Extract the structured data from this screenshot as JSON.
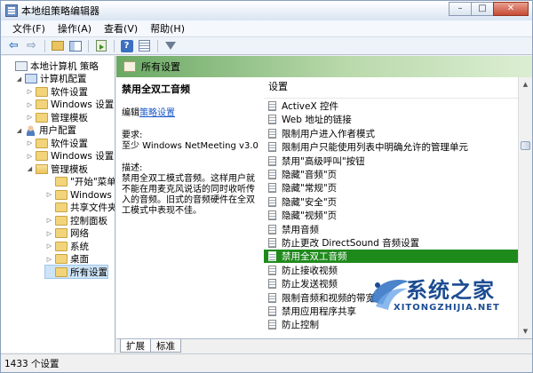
{
  "window": {
    "title": "本地组策略编辑器",
    "controls": {
      "minimize": "–",
      "maximize": "□",
      "close": "✕"
    }
  },
  "menu": [
    "文件(F)",
    "操作(A)",
    "查看(V)",
    "帮助(H)"
  ],
  "toolbar": {
    "icons": [
      "back-arrow-icon",
      "forward-arrow-icon",
      "up-folder-icon",
      "show-pane-icon",
      "export-list-icon",
      "help-icon",
      "properties-icon",
      "filter-icon"
    ],
    "back_glyph": "⇦",
    "forward_glyph": "⇨",
    "help_glyph": "?"
  },
  "tree": [
    {
      "label": "本地计算机 策略",
      "depth": 0,
      "expander": "",
      "icon": "root",
      "selected": false
    },
    {
      "label": "计算机配置",
      "depth": 1,
      "expander": "◢",
      "icon": "computer",
      "selected": false
    },
    {
      "label": "软件设置",
      "depth": 2,
      "expander": "▷",
      "icon": "folder",
      "selected": false
    },
    {
      "label": "Windows 设置",
      "depth": 2,
      "expander": "▷",
      "icon": "folder",
      "selected": false
    },
    {
      "label": "管理模板",
      "depth": 2,
      "expander": "▷",
      "icon": "folder",
      "selected": false
    },
    {
      "label": "用户配置",
      "depth": 1,
      "expander": "◢",
      "icon": "user",
      "selected": false
    },
    {
      "label": "软件设置",
      "depth": 2,
      "expander": "▷",
      "icon": "folder",
      "selected": false
    },
    {
      "label": "Windows 设置",
      "depth": 2,
      "expander": "▷",
      "icon": "folder",
      "selected": false
    },
    {
      "label": "管理模板",
      "depth": 2,
      "expander": "◢",
      "icon": "folder-open",
      "selected": false
    },
    {
      "label": "\"开始\"菜单和",
      "depth": 3,
      "expander": "",
      "icon": "folder",
      "selected": false
    },
    {
      "label": "Windows 组件",
      "depth": 3,
      "expander": "▷",
      "icon": "folder",
      "selected": false
    },
    {
      "label": "共享文件夹",
      "depth": 3,
      "expander": "",
      "icon": "folder",
      "selected": false
    },
    {
      "label": "控制面板",
      "depth": 3,
      "expander": "▷",
      "icon": "folder",
      "selected": false
    },
    {
      "label": "网络",
      "depth": 3,
      "expander": "▷",
      "icon": "folder",
      "selected": false
    },
    {
      "label": "系统",
      "depth": 3,
      "expander": "▷",
      "icon": "folder",
      "selected": false
    },
    {
      "label": "桌面",
      "depth": 3,
      "expander": "▷",
      "icon": "folder",
      "selected": false
    },
    {
      "label": "所有设置",
      "depth": 3,
      "expander": "",
      "icon": "folder",
      "selected": true
    }
  ],
  "panel": {
    "header": "所有设置",
    "description": {
      "title": "禁用全双工音频",
      "edit_prefix": "编辑",
      "edit_link": "策略设置",
      "requirement_label": "要求:",
      "requirement_value": "至少 Windows NetMeeting v3.0",
      "desc_label": "描述:",
      "desc_text": "禁用全双工模式音频。这样用户就不能在用麦克风说话的同时收听传入的音频。旧式的音频硬件在全双工模式中表现不佳。"
    },
    "list_header": "设置",
    "settings": [
      {
        "label": "ActiveX 控件",
        "selected": false
      },
      {
        "label": "Web 地址的链接",
        "selected": false
      },
      {
        "label": "限制用户进入作者模式",
        "selected": false
      },
      {
        "label": "限制用户只能使用列表中明确允许的管理单元",
        "selected": false
      },
      {
        "label": "禁用\"高级呼叫\"按钮",
        "selected": false
      },
      {
        "label": "隐藏\"音频\"页",
        "selected": false
      },
      {
        "label": "隐藏\"常规\"页",
        "selected": false
      },
      {
        "label": "隐藏\"安全\"页",
        "selected": false
      },
      {
        "label": "隐藏\"视频\"页",
        "selected": false
      },
      {
        "label": "禁用音频",
        "selected": false
      },
      {
        "label": "防止更改 DirectSound 音频设置",
        "selected": false
      },
      {
        "label": "禁用全双工音频",
        "selected": true
      },
      {
        "label": "防止接收视频",
        "selected": false
      },
      {
        "label": "防止发送视频",
        "selected": false
      },
      {
        "label": "限制音频和视频的带宽",
        "selected": false
      },
      {
        "label": "禁用应用程序共享",
        "selected": false
      },
      {
        "label": "防止控制",
        "selected": false
      }
    ],
    "scrollbar": {
      "up": "▲",
      "down": "▼"
    }
  },
  "tabs": [
    {
      "label": "扩展",
      "active": true
    },
    {
      "label": "标准",
      "active": false
    }
  ],
  "status": "1433 个设置",
  "watermark": {
    "text": "系统之家",
    "sub": "XITONGZHIJIA.NET"
  },
  "colors": {
    "selection": "#1f8a1c",
    "header_band": "#6aa863",
    "link": "#1a57c7",
    "watermark": "#1c4c92"
  }
}
